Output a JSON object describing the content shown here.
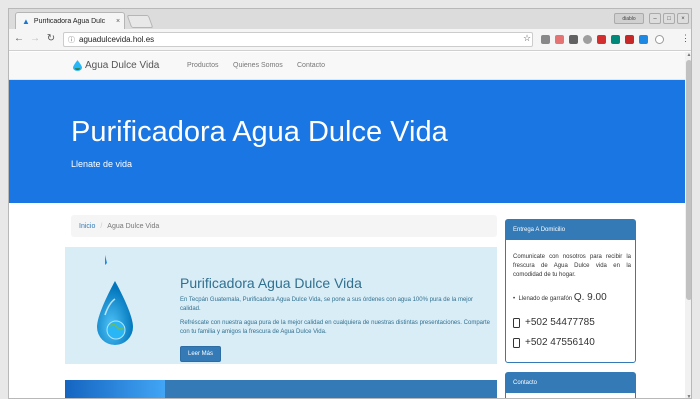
{
  "browser": {
    "tab_title": "Purificadora Agua Dulc",
    "tab_close": "×",
    "user_chip": "diablo",
    "url": "aguadulcevida.hol.es"
  },
  "site": {
    "brand": "Agua Dulce Vida",
    "nav": [
      "Productos",
      "Quienes Somos",
      "Contacto"
    ]
  },
  "hero": {
    "title": "Purificadora Agua Dulce Vida",
    "subtitle": "Llenate de vida"
  },
  "breadcrumb": {
    "home": "Inicio",
    "separator": "/",
    "current": "Agua Dulce Vida"
  },
  "feature": {
    "title": "Purificadora Agua Dulce Vida",
    "paragraph1": "En Tecpán Guatemala, Purificadora Agua Dulce Vida, se pone a sus órdenes con agua 100% pura de la mejor calidad.",
    "paragraph2": "Refréscate con nuestra agua pura de la mejor calidad en cualquiera de nuestras distintas presentaciones. Comparte con tu familia y amigos la frescura de Agua Dulce Vida.",
    "button": "Leer Más"
  },
  "delivery_panel": {
    "heading": "Entrega A Domicilio",
    "intro": "Comunicate con nosotros para recibir la frescura de Agua Dulce vida en la comodidad de tu hogar.",
    "bullet_label": "Llenado de garrafón",
    "bullet_price": "Q. 9.00",
    "phone1": "+502 54477785",
    "phone2": "+502 47556140"
  },
  "contact_panel": {
    "heading": "Contacto"
  },
  "colors": {
    "hero_blue": "#1a76e3",
    "panel_blue": "#337ab7",
    "feature_bg": "#d9edf7"
  }
}
